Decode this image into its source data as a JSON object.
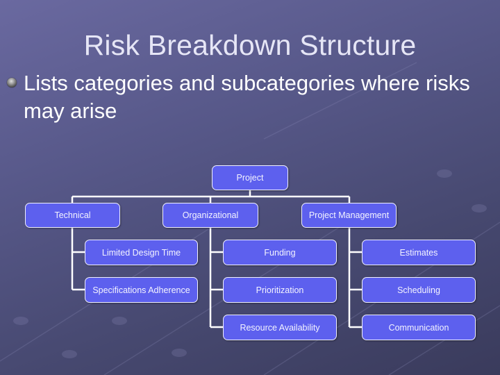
{
  "slide": {
    "title": "Risk Breakdown Structure",
    "bullet": "Lists categories and subcategories where risks may arise"
  },
  "colors": {
    "node_fill": "#5d60ee",
    "node_border": "#f0f0ff",
    "connector": "#ffffff",
    "background_top": "#6a69a0",
    "background_bottom": "#3a3b5c"
  },
  "diagram": {
    "root": "Project",
    "categories": [
      {
        "label": "Technical",
        "children": [
          "Limited Design Time",
          "Specifications Adherence"
        ]
      },
      {
        "label": "Organizational",
        "children": [
          "Funding",
          "Prioritization",
          "Resource Availability"
        ]
      },
      {
        "label": "Project Management",
        "children": [
          "Estimates",
          "Scheduling",
          "Communication"
        ]
      }
    ]
  }
}
